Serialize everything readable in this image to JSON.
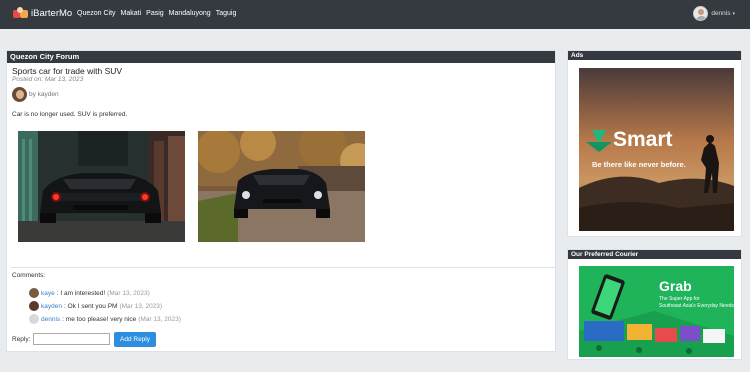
{
  "nav": {
    "brand": "iBarterMo",
    "links": [
      "Quezon City",
      "Makati",
      "Pasig",
      "Mandaluyong",
      "Taguig"
    ],
    "user": "dennis",
    "caret": "▾"
  },
  "forum": {
    "header": "Quezon City Forum",
    "post": {
      "title": "Sports car for trade with SUV",
      "posted_on": "Posted on: Mar 13, 2023",
      "author_prefix": "by ",
      "author": "kayden",
      "body": "Car is no longer used. SUV is preferred."
    },
    "comments_label": "Comments:",
    "comments": [
      {
        "user": "kaye",
        "text": "I am interested!",
        "date": "(Mar 13, 2023)"
      },
      {
        "user": "kayden",
        "text": "Ok I sent you PM",
        "date": "(Mar 13, 2023)"
      },
      {
        "user": "dennis",
        "text": "me too please! very nice",
        "date": "(Mar 13, 2023)"
      }
    ],
    "reply_label": "Reply:",
    "reply_placeholder": "",
    "reply_button": "Add Reply"
  },
  "ads": {
    "header": "Ads",
    "brand": "Smart",
    "tagline": "Be there like never before."
  },
  "courier": {
    "header": "Our Preferred Courier",
    "brand": "Grab",
    "tagline_1": "The Super App for",
    "tagline_2": "Southeast Asia's Everyday Needs"
  },
  "colors": {
    "navbar": "#343a40",
    "accent": "#2d8ee0",
    "link": "#3b7fc4",
    "smart_green": "#1fb87a",
    "grab_green": "#1fb35a"
  }
}
